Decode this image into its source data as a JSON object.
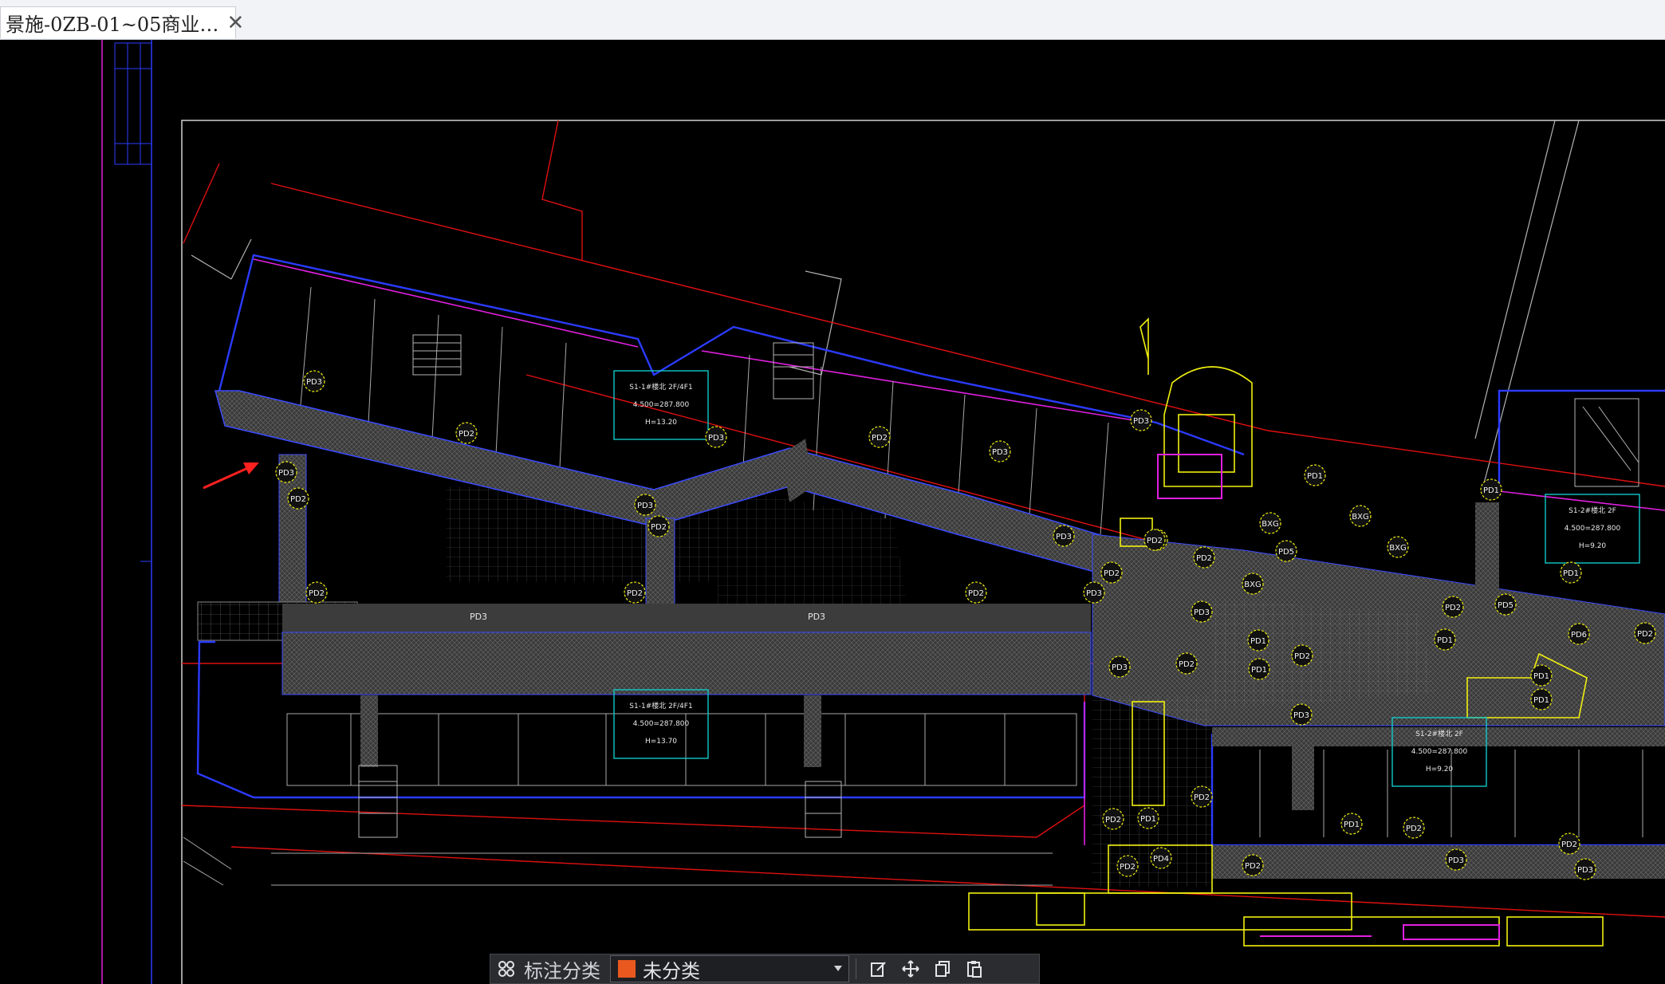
{
  "tab": {
    "title": "景施-0ZB-01~05商业…",
    "close_glyph": "✕"
  },
  "drawing": {
    "room_labels": {
      "block_a": [
        "S1-1#楼北 2F/4F1",
        "4.500=287.800",
        "H=13.20"
      ],
      "block_b": [
        "S1-1#楼北 2F/4F1",
        "4.500=287.800",
        "H=13.70"
      ],
      "block_c": [
        "S1-2#楼北 2F",
        "4.500=287.800",
        "H=9.20"
      ],
      "block_d": [
        "S1-2#楼北 2F",
        "4.500=287.800",
        "H=9.20"
      ]
    },
    "circle_tags": [
      "PD3",
      "PD2",
      "PD3",
      "PD2",
      "PD3",
      "PD2",
      "PD3",
      "PD2",
      "PD3",
      "PD3",
      "PD2",
      "PD2",
      "PD3",
      "PD1",
      "BXG",
      "PD5",
      "BXG",
      "BXG",
      "PD1",
      "PD2",
      "PD1",
      "PD5",
      "PD1",
      "PD1",
      "PD6",
      "PD2",
      "BXG",
      "PD2",
      "PD2",
      "PD1",
      "PD3",
      "PD2",
      "PD3",
      "PD2",
      "PD2",
      "PD2",
      "PD3",
      "PD1",
      "PD2",
      "PD1",
      "PD3",
      "PD2",
      "PD2",
      "PD1",
      "PD4",
      "PD2",
      "PD1",
      "PD2",
      "PD2",
      "PD3",
      "PD2",
      "PD3"
    ],
    "corridor_labels": [
      "PD3",
      "PD3"
    ],
    "colors": {
      "background": "#000000",
      "boundary_red": "#e01010",
      "wall_blue": "#2b3bff",
      "magenta": "#e020e0",
      "yellow": "#f0f010",
      "cyan": "#10c8c8",
      "line_gray": "#b4b4b4",
      "arrow": "#ff2020"
    }
  },
  "toolbar": {
    "grid_icon": "grid-icon",
    "category_label": "标注分类",
    "category_value": "未分类",
    "swatch_color": "#e8581f",
    "tools": [
      "edit-icon",
      "move-icon",
      "copy-icon",
      "paste-icon"
    ]
  }
}
